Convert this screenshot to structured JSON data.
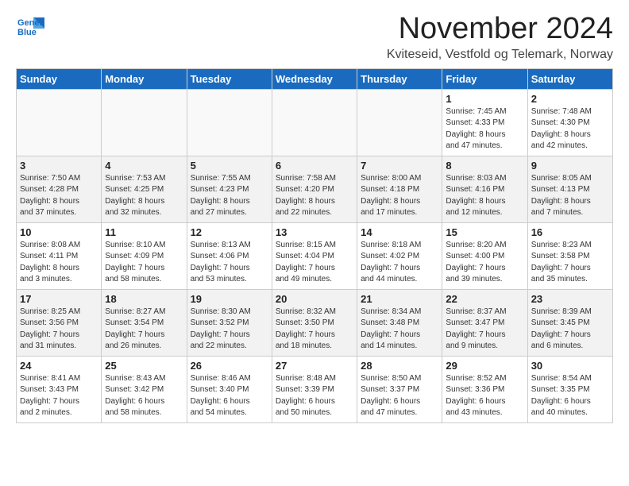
{
  "header": {
    "logo_line1": "General",
    "logo_line2": "Blue",
    "month_title": "November 2024",
    "location": "Kviteseid, Vestfold og Telemark, Norway"
  },
  "weekdays": [
    "Sunday",
    "Monday",
    "Tuesday",
    "Wednesday",
    "Thursday",
    "Friday",
    "Saturday"
  ],
  "weeks": [
    [
      {
        "day": "",
        "info": ""
      },
      {
        "day": "",
        "info": ""
      },
      {
        "day": "",
        "info": ""
      },
      {
        "day": "",
        "info": ""
      },
      {
        "day": "",
        "info": ""
      },
      {
        "day": "1",
        "info": "Sunrise: 7:45 AM\nSunset: 4:33 PM\nDaylight: 8 hours\nand 47 minutes."
      },
      {
        "day": "2",
        "info": "Sunrise: 7:48 AM\nSunset: 4:30 PM\nDaylight: 8 hours\nand 42 minutes."
      }
    ],
    [
      {
        "day": "3",
        "info": "Sunrise: 7:50 AM\nSunset: 4:28 PM\nDaylight: 8 hours\nand 37 minutes."
      },
      {
        "day": "4",
        "info": "Sunrise: 7:53 AM\nSunset: 4:25 PM\nDaylight: 8 hours\nand 32 minutes."
      },
      {
        "day": "5",
        "info": "Sunrise: 7:55 AM\nSunset: 4:23 PM\nDaylight: 8 hours\nand 27 minutes."
      },
      {
        "day": "6",
        "info": "Sunrise: 7:58 AM\nSunset: 4:20 PM\nDaylight: 8 hours\nand 22 minutes."
      },
      {
        "day": "7",
        "info": "Sunrise: 8:00 AM\nSunset: 4:18 PM\nDaylight: 8 hours\nand 17 minutes."
      },
      {
        "day": "8",
        "info": "Sunrise: 8:03 AM\nSunset: 4:16 PM\nDaylight: 8 hours\nand 12 minutes."
      },
      {
        "day": "9",
        "info": "Sunrise: 8:05 AM\nSunset: 4:13 PM\nDaylight: 8 hours\nand 7 minutes."
      }
    ],
    [
      {
        "day": "10",
        "info": "Sunrise: 8:08 AM\nSunset: 4:11 PM\nDaylight: 8 hours\nand 3 minutes."
      },
      {
        "day": "11",
        "info": "Sunrise: 8:10 AM\nSunset: 4:09 PM\nDaylight: 7 hours\nand 58 minutes."
      },
      {
        "day": "12",
        "info": "Sunrise: 8:13 AM\nSunset: 4:06 PM\nDaylight: 7 hours\nand 53 minutes."
      },
      {
        "day": "13",
        "info": "Sunrise: 8:15 AM\nSunset: 4:04 PM\nDaylight: 7 hours\nand 49 minutes."
      },
      {
        "day": "14",
        "info": "Sunrise: 8:18 AM\nSunset: 4:02 PM\nDaylight: 7 hours\nand 44 minutes."
      },
      {
        "day": "15",
        "info": "Sunrise: 8:20 AM\nSunset: 4:00 PM\nDaylight: 7 hours\nand 39 minutes."
      },
      {
        "day": "16",
        "info": "Sunrise: 8:23 AM\nSunset: 3:58 PM\nDaylight: 7 hours\nand 35 minutes."
      }
    ],
    [
      {
        "day": "17",
        "info": "Sunrise: 8:25 AM\nSunset: 3:56 PM\nDaylight: 7 hours\nand 31 minutes."
      },
      {
        "day": "18",
        "info": "Sunrise: 8:27 AM\nSunset: 3:54 PM\nDaylight: 7 hours\nand 26 minutes."
      },
      {
        "day": "19",
        "info": "Sunrise: 8:30 AM\nSunset: 3:52 PM\nDaylight: 7 hours\nand 22 minutes."
      },
      {
        "day": "20",
        "info": "Sunrise: 8:32 AM\nSunset: 3:50 PM\nDaylight: 7 hours\nand 18 minutes."
      },
      {
        "day": "21",
        "info": "Sunrise: 8:34 AM\nSunset: 3:48 PM\nDaylight: 7 hours\nand 14 minutes."
      },
      {
        "day": "22",
        "info": "Sunrise: 8:37 AM\nSunset: 3:47 PM\nDaylight: 7 hours\nand 9 minutes."
      },
      {
        "day": "23",
        "info": "Sunrise: 8:39 AM\nSunset: 3:45 PM\nDaylight: 7 hours\nand 6 minutes."
      }
    ],
    [
      {
        "day": "24",
        "info": "Sunrise: 8:41 AM\nSunset: 3:43 PM\nDaylight: 7 hours\nand 2 minutes."
      },
      {
        "day": "25",
        "info": "Sunrise: 8:43 AM\nSunset: 3:42 PM\nDaylight: 6 hours\nand 58 minutes."
      },
      {
        "day": "26",
        "info": "Sunrise: 8:46 AM\nSunset: 3:40 PM\nDaylight: 6 hours\nand 54 minutes."
      },
      {
        "day": "27",
        "info": "Sunrise: 8:48 AM\nSunset: 3:39 PM\nDaylight: 6 hours\nand 50 minutes."
      },
      {
        "day": "28",
        "info": "Sunrise: 8:50 AM\nSunset: 3:37 PM\nDaylight: 6 hours\nand 47 minutes."
      },
      {
        "day": "29",
        "info": "Sunrise: 8:52 AM\nSunset: 3:36 PM\nDaylight: 6 hours\nand 43 minutes."
      },
      {
        "day": "30",
        "info": "Sunrise: 8:54 AM\nSunset: 3:35 PM\nDaylight: 6 hours\nand 40 minutes."
      }
    ]
  ]
}
